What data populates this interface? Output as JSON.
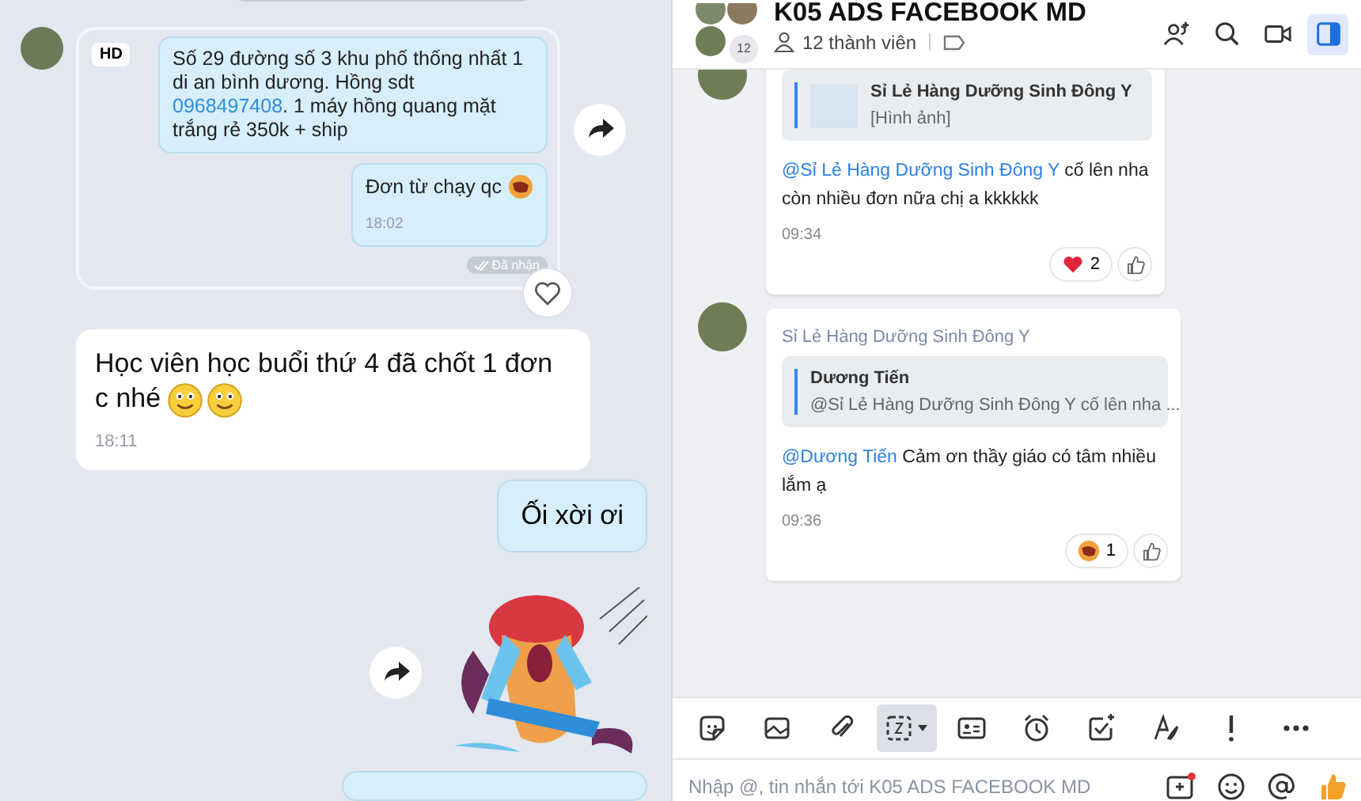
{
  "left_chat": {
    "bundle": {
      "badge": "HD",
      "messages": [
        {
          "parts": [
            {
              "kind": "plain",
              "text": "Số 29 đường số 3 khu phố thống nhất 1 di an bình dương. Hồng sdt "
            },
            {
              "kind": "link",
              "text": "0968497408"
            },
            {
              "kind": "plain",
              "text": ". 1 máy hồng quang mặt trắng rẻ 350k + ship"
            }
          ]
        },
        {
          "parts": [
            {
              "kind": "plain",
              "text": "Đơn từ chạy qc"
            }
          ],
          "emoji": [
            {
              "kind": "laugh"
            }
          ],
          "time": "18:02"
        }
      ],
      "status": "Đã nhận"
    },
    "incoming": {
      "text": "Học viên học buổi thứ 4 đã chốt 1 đơn c nhé",
      "emoji": [
        {
          "kind": "smile"
        },
        {
          "kind": "smile"
        }
      ],
      "time": "18:11"
    },
    "outgoing": {
      "text": "Ối xời ơi"
    }
  },
  "group": {
    "title": "K05 ADS FACEBOOK MD",
    "members": "12 thành viên",
    "avatar_count": "12",
    "header_actions": [
      {
        "kind": "add-member",
        "selected": false
      },
      {
        "kind": "search",
        "selected": false
      },
      {
        "kind": "video",
        "selected": false
      },
      {
        "kind": "sidebar",
        "selected": true
      }
    ]
  },
  "messages": [
    {
      "quote": {
        "title": "Sỉ Lẻ Hàng Dưỡng Sinh Đông Y",
        "body": "[Hình ảnh]",
        "kind": "image"
      },
      "mention": "@Sỉ Lẻ Hàng Dưỡng Sinh Đông Y",
      "text": " cố lên nha còn nhiều đơn nữa chị a kkkkkk",
      "time": "09:34",
      "reaction": {
        "kind": "heart",
        "count": "2"
      }
    },
    {
      "sender": "Sỉ Lẻ Hàng Dưỡng Sinh Đông Y",
      "quote": {
        "title": "Dương Tiến",
        "body": "@Sỉ Lẻ Hàng Dưỡng Sinh Đông Y cố lên nha ...",
        "kind": "text"
      },
      "mention": "@Dương Tiến",
      "text": " Cảm ơn thầy giáo có tâm nhiều lắm ạ",
      "time": "09:36",
      "reaction": {
        "kind": "laugh",
        "count": "1"
      }
    }
  ],
  "toolbar": [
    {
      "kind": "sticker",
      "selected": false
    },
    {
      "kind": "image",
      "selected": false
    },
    {
      "kind": "attach",
      "selected": false
    },
    {
      "kind": "screenshot",
      "selected": true
    },
    {
      "kind": "card",
      "selected": false
    },
    {
      "kind": "alarm",
      "selected": false
    },
    {
      "kind": "task",
      "selected": false
    },
    {
      "kind": "format",
      "selected": false
    },
    {
      "kind": "urgent",
      "selected": false
    },
    {
      "kind": "more",
      "selected": false
    }
  ],
  "composer": {
    "placeholder": "Nhập @, tin nhắn tới K05 ADS FACEBOOK MD",
    "actions": [
      {
        "kind": "quick-message"
      },
      {
        "kind": "emoji"
      },
      {
        "kind": "mention"
      },
      {
        "kind": "like"
      }
    ]
  }
}
